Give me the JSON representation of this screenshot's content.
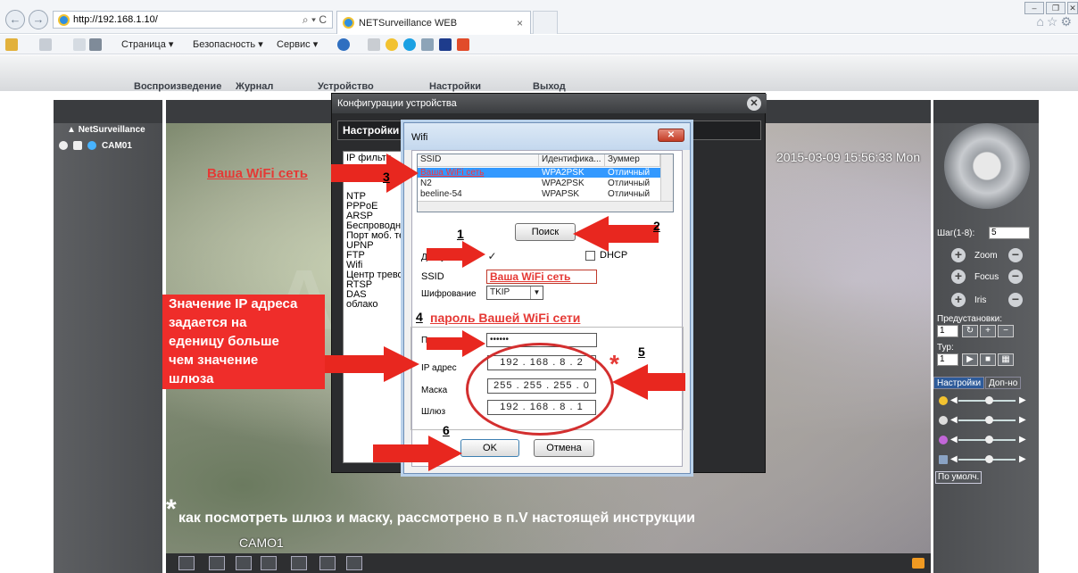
{
  "browser": {
    "url": "http://192.168.1.10/",
    "addr_controls": "⌕ ▾ C",
    "tab_title": "NETSurveillance WEB",
    "tab_close": "×",
    "commands": [
      "Страница ▾",
      "Безопасность ▾",
      "Сервис ▾"
    ],
    "window_buttons": [
      "‒",
      "❐",
      "✕"
    ]
  },
  "app": {
    "menu": [
      "Воспроизведение",
      "Журнал",
      "Устройство",
      "Настройки",
      "Выход"
    ],
    "sidebar_title": "NetSurveillance",
    "camera": "CAM01",
    "timestamp": "2015-03-09 15:56:33 Mon",
    "video_label": "CAMO1",
    "ptz": {
      "step_label": "Шаг(1-8):",
      "step_value": "5",
      "zoom": "Zoom",
      "focus": "Focus",
      "iris": "Iris",
      "presets_label": "Предустановки:",
      "preset_value": "1",
      "type_label": "Тур:",
      "type_value": "1",
      "tab_settings": "Настройки",
      "tab_extra": "Доп-но",
      "default_btn": "По умолч."
    }
  },
  "config_dialog": {
    "title": "Конфигурации устройства",
    "subtitle": "Настройки -",
    "menu_items": [
      "IP фильтр",
      "",
      "",
      "NTP",
      "PPPoE",
      "ARSP",
      "Беспроводна",
      "Порт моб. тел",
      "UPNP",
      "FTP",
      "Wifi",
      "Центр тревог",
      "RTSP",
      "DAS",
      "облако"
    ]
  },
  "wifi_dialog": {
    "title": "Wifi",
    "close": "✕",
    "columns": [
      "SSID",
      "Идентифика...",
      "Зуммер"
    ],
    "networks": [
      {
        "ssid": "Ваша WiFi сеть",
        "auth": "WPA2PSK",
        "signal": "Отличный",
        "selected": true
      },
      {
        "ssid": "N2",
        "auth": "WPA2PSK",
        "signal": "Отличный",
        "selected": false
      },
      {
        "ssid": "beeline-54",
        "auth": "WPAPSK",
        "signal": "Отличный",
        "selected": false
      }
    ],
    "search_btn": "Поиск",
    "enabled_label": "Доступен",
    "enabled_checked": "✓",
    "dhcp_label": "DHCP",
    "ssid_label": "SSID",
    "ssid_value": "Ваша WiFi сеть",
    "encryption_label": "Шифрование",
    "encryption_value": "TKIP",
    "password_label": "Пароль",
    "password_value": "••••••",
    "ip_label": "IP адрес",
    "ip_value": "192 . 168 . 8 . 2",
    "mask_label": "Маска",
    "mask_value": "255 . 255 . 255 . 0",
    "gateway_label": "Шлюз",
    "gateway_value": "192 . 168 . 8 . 1",
    "ok_btn": "OK",
    "cancel_btn": "Отмена"
  },
  "annotations": {
    "your_wifi": "Ваша WiFi сеть",
    "your_password": "пароль Вашей WiFi сети",
    "ip_note": [
      "Значение IP адреса",
      "задается на",
      "еденицу больше",
      "чем значение",
      "шлюза"
    ],
    "footnote": "как посмотреть шлюз и маску, рассмотрено в п.V настоящей инструкции",
    "asterisk": "*",
    "steps": [
      "1",
      "2",
      "3",
      "4",
      "5",
      "6"
    ]
  },
  "colors": {
    "annotation_red": "#e53935",
    "selection_blue": "#3399ff",
    "panel_dark": "#4c4e51"
  }
}
